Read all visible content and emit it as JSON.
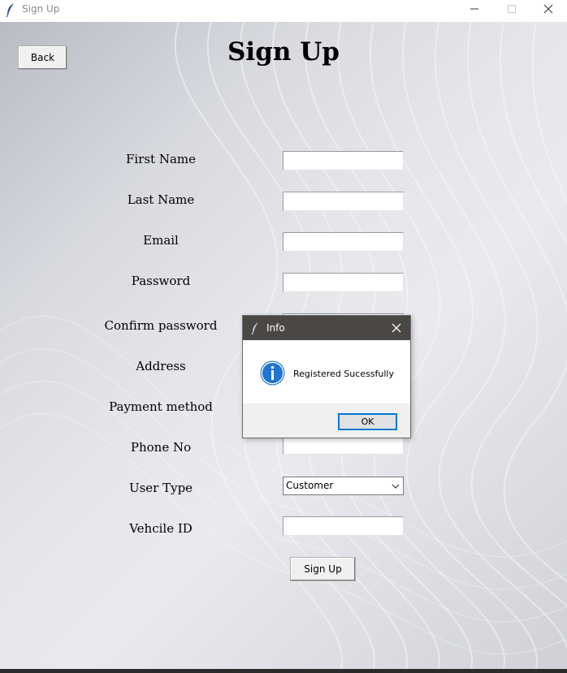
{
  "window": {
    "title": "Sign Up",
    "app_icon": "feather-icon"
  },
  "toolbar": {
    "back_label": "Back"
  },
  "page": {
    "heading": "Sign Up"
  },
  "form": {
    "fields": [
      {
        "label": "First Name",
        "value": ""
      },
      {
        "label": "Last Name",
        "value": ""
      },
      {
        "label": "Email",
        "value": ""
      },
      {
        "label": "Password",
        "value": ""
      },
      {
        "label": "Confirm password",
        "value": ""
      },
      {
        "label": "Address",
        "value": ""
      },
      {
        "label": "Payment method",
        "value": ""
      },
      {
        "label": "Phone No",
        "value": ""
      },
      {
        "label": "User Type",
        "value": "Customer"
      },
      {
        "label": "Vehcile ID",
        "value": ""
      }
    ],
    "submit_label": "Sign Up"
  },
  "dialog": {
    "title": "Info",
    "message": "Registered Sucessfully",
    "ok_label": "OK",
    "icon": "info-icon",
    "titlebar_color": "#4a4744",
    "accent": "#0078d7"
  }
}
